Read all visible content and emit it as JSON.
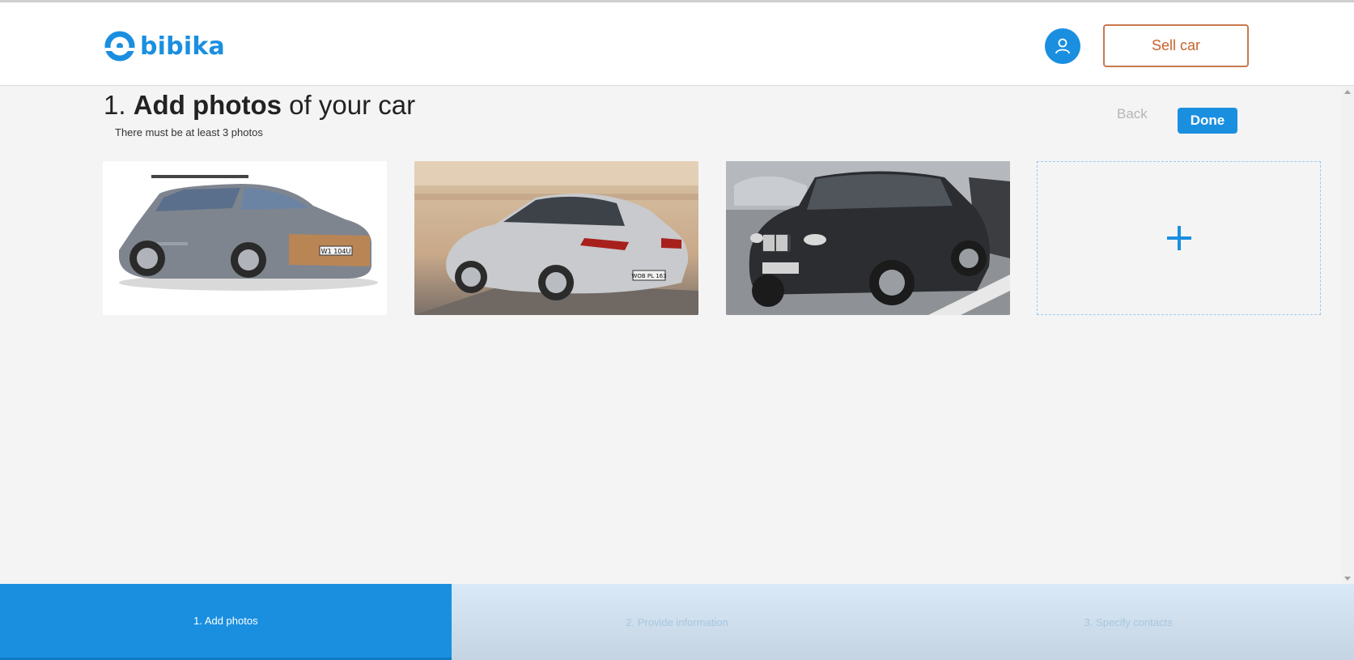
{
  "header": {
    "logo_text": "bibika",
    "logo_icon": "bibika-logo-icon",
    "user_icon": "user-icon",
    "sell_label": "Sell car",
    "brand_color": "#1a8fe0",
    "sell_color": "#c8632e"
  },
  "page": {
    "title_prefix": "1.",
    "title_bold": "Add photos",
    "title_rest": "of your car",
    "subtitle": "There must be at least 3 photos",
    "back_label": "Back",
    "done_label": "Done"
  },
  "photos": [
    {
      "alt": "Grey Volkswagen Passat wagon",
      "plate": "W1 104U"
    },
    {
      "alt": "Silver Volkswagen Passat sedan rear",
      "plate": "WOB PL 163"
    },
    {
      "alt": "Black BMW X5 in parking lot",
      "plate": ""
    }
  ],
  "add_tile": {
    "symbol": "+",
    "icon": "plus-icon"
  },
  "steps": [
    {
      "label": "1. Add photos",
      "active": true
    },
    {
      "label": "2. Provide information",
      "active": false
    },
    {
      "label": "3. Specify contacts",
      "active": false
    }
  ]
}
